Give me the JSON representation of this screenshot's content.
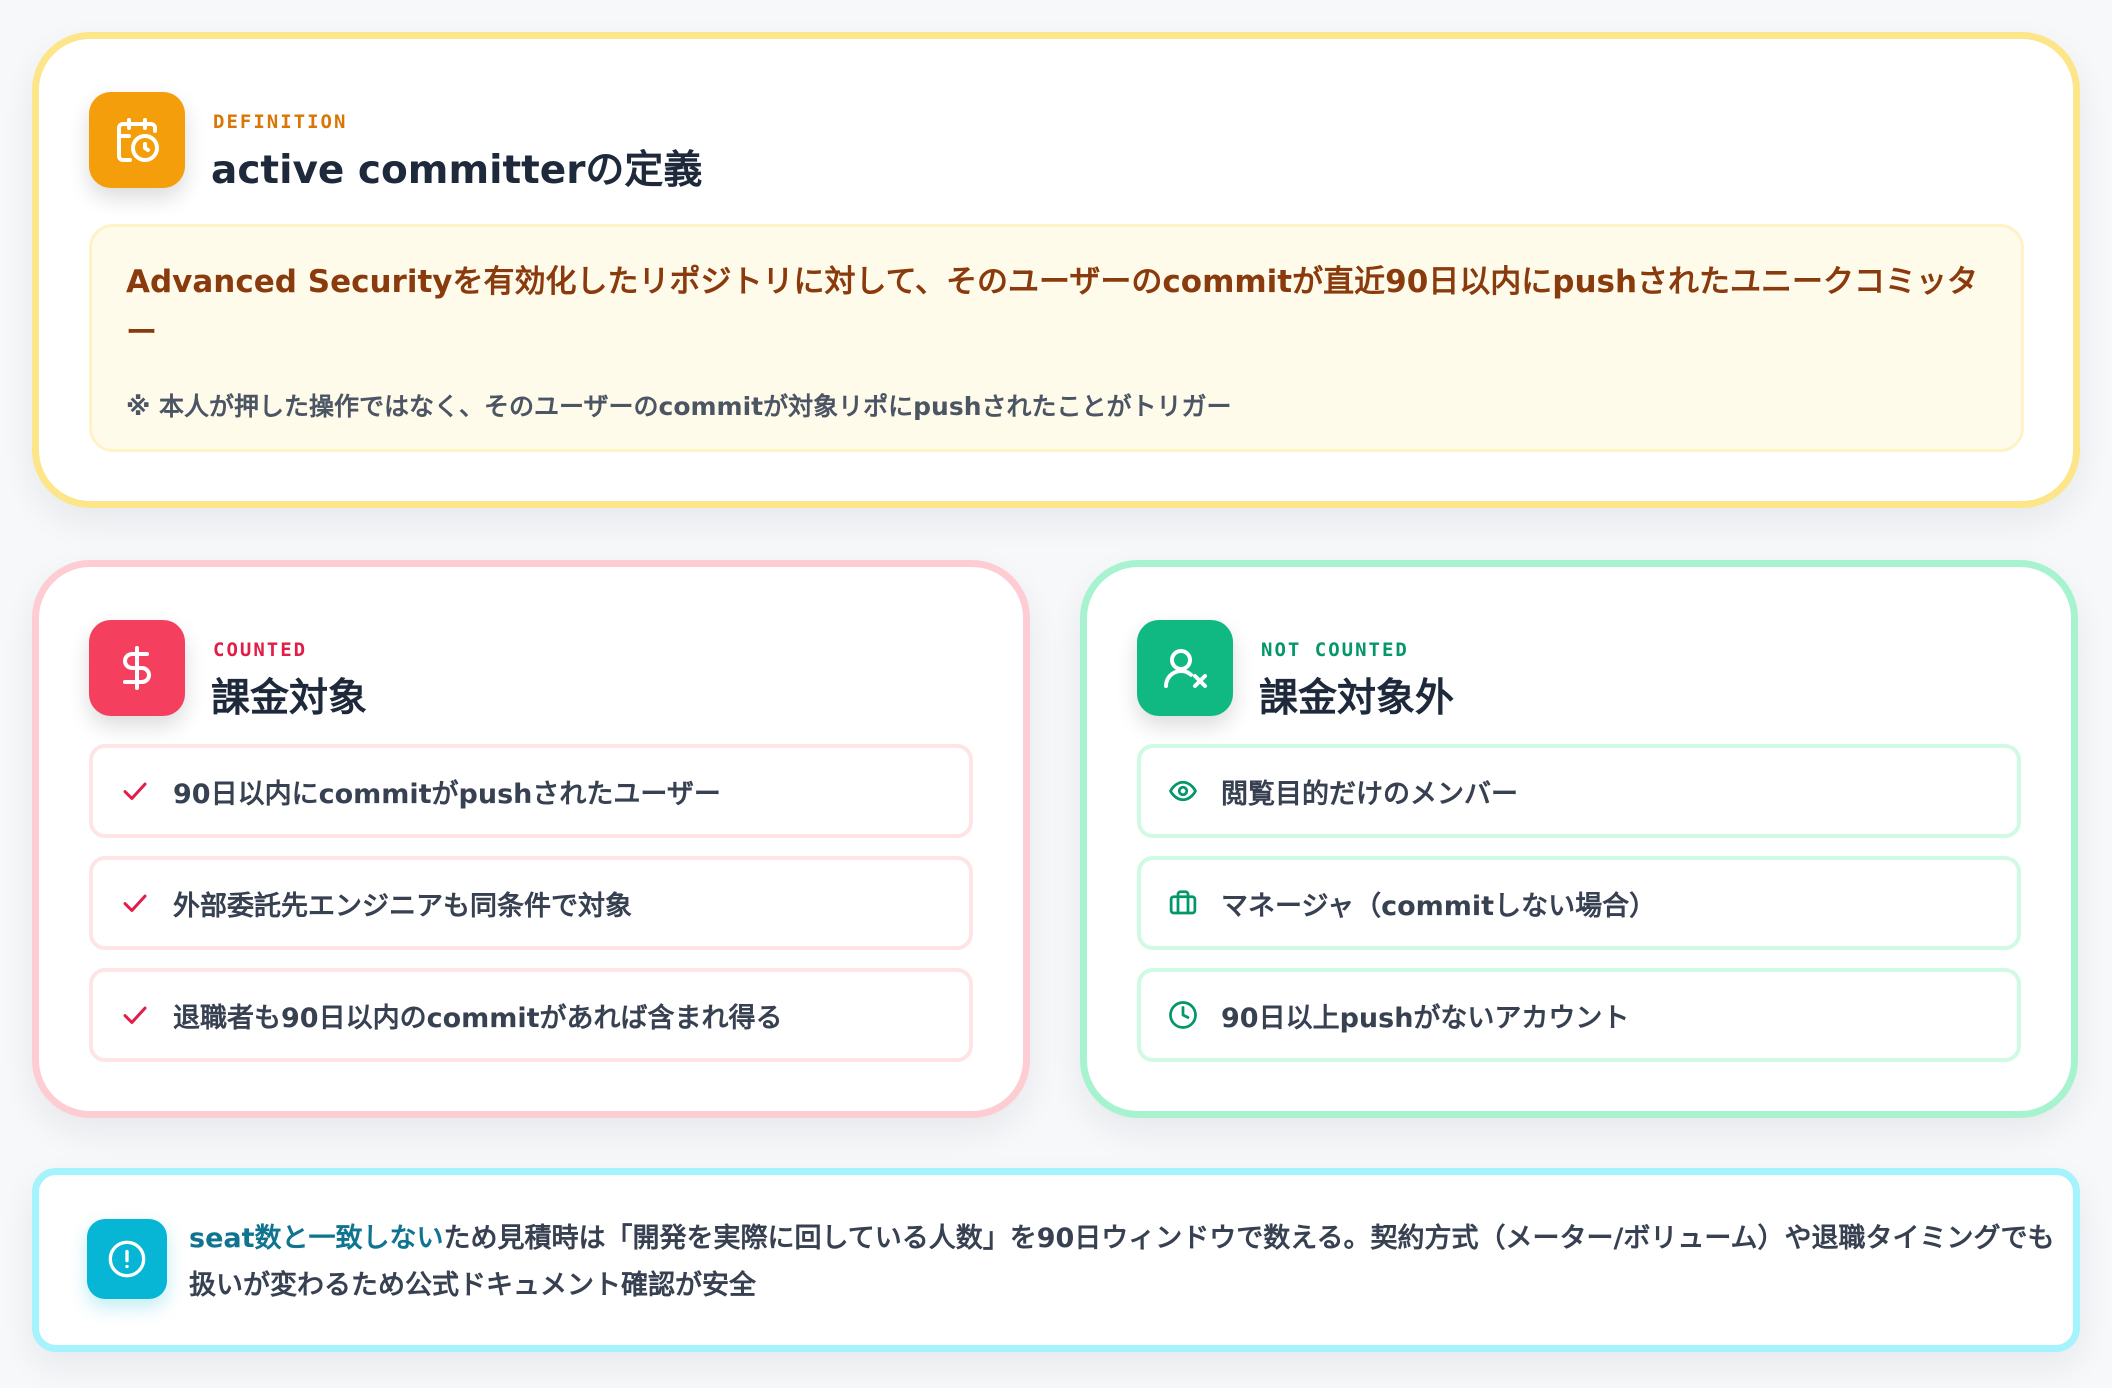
{
  "colors": {
    "definition_accent": "#f59e0b",
    "counted_accent": "#f43f5e",
    "not_counted_accent": "#10b981",
    "note_accent": "#06b6d4"
  },
  "definition": {
    "icon": "calendar-clock-icon",
    "eyebrow": "DEFINITION",
    "title": "active committerの定義",
    "main_text": "Advanced Securityを有効化したリポジトリに対して、そのユーザーのcommitが直近90日以内にpushされたユニークコミッター",
    "sub_text": "※ 本人が押した操作ではなく、そのユーザーのcommitが対象リポにpushされたことがトリガー"
  },
  "counted": {
    "icon": "dollar-icon",
    "eyebrow": "COUNTED",
    "title": "課金対象",
    "items": [
      {
        "icon": "check-icon",
        "label": "90日以内にcommitがpushされたユーザー"
      },
      {
        "icon": "check-icon",
        "label": "外部委託先エンジニアも同条件で対象"
      },
      {
        "icon": "check-icon",
        "label": "退職者も90日以内のcommitがあれば含まれ得る"
      }
    ]
  },
  "not_counted": {
    "icon": "user-x-icon",
    "eyebrow": "NOT COUNTED",
    "title": "課金対象外",
    "items": [
      {
        "icon": "eye-icon",
        "label": "閲覧目的だけのメンバー"
      },
      {
        "icon": "briefcase-icon",
        "label": "マネージャ（commitしない場合）"
      },
      {
        "icon": "clock-icon",
        "label": "90日以上pushがないアカウント"
      }
    ]
  },
  "note": {
    "icon": "alert-circle-icon",
    "emphasis": "seat数と一致しない",
    "text": "ため見積時は「開発を実際に回している人数」を90日ウィンドウで数える。契約方式（メーター/ボリューム）や退職タイミングでも扱いが変わるため公式ドキュメント確認が安全"
  }
}
